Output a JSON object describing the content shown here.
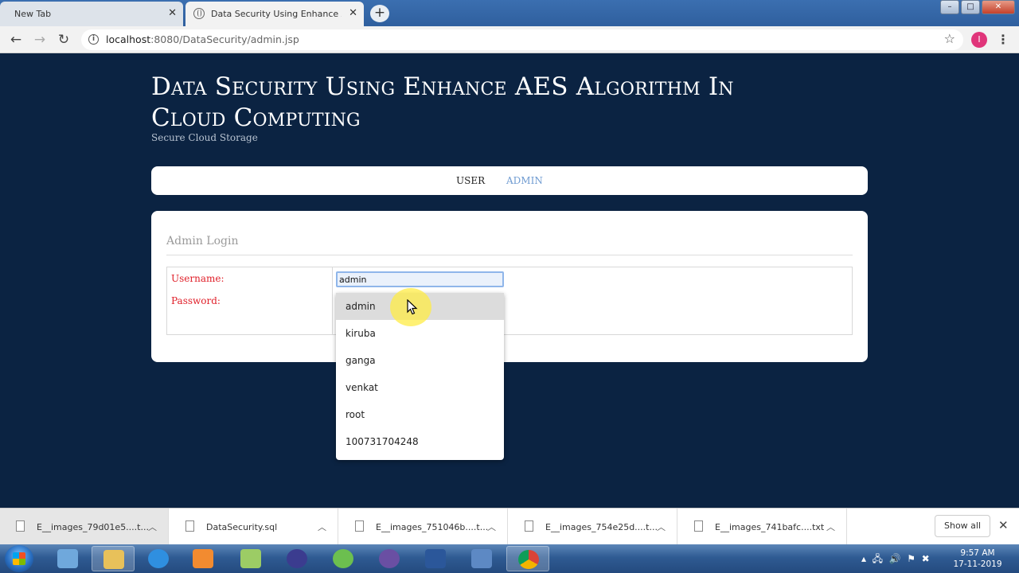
{
  "browser": {
    "tabs": [
      {
        "title": "New Tab",
        "active": false
      },
      {
        "title": "Data Security Using Enhance AES",
        "active": true
      }
    ],
    "url_host": "localhost",
    "url_path": ":8080/DataSecurity/admin.jsp",
    "profile_initial": "I"
  },
  "site": {
    "title": "Data Security Using Enhance AES Algorithm In Cloud Computing",
    "subtitle": "Secure Cloud Storage",
    "nav": [
      "USER",
      "ADMIN"
    ]
  },
  "login": {
    "heading": "Admin Login",
    "username_label": "Username:",
    "password_label": "Password:",
    "username_value": "admin",
    "suggestions": [
      "admin",
      "kiruba",
      "ganga",
      "venkat",
      "root",
      "100731704248"
    ]
  },
  "downloads": {
    "items": [
      "E__images_79d01e5....t...",
      "DataSecurity.sql",
      "E__images_751046b....t...",
      "E__images_754e25d....t...",
      "E__images_741bafc....txt"
    ],
    "show_all": "Show all"
  },
  "taskbar": {
    "time": "9:57 AM",
    "date": "17-11-2019"
  },
  "colors": {
    "page_bg": "#0b2342",
    "label_red": "#e0202a",
    "admin_link": "#6f9bd1",
    "cursor_highlight": "#ffec46"
  }
}
